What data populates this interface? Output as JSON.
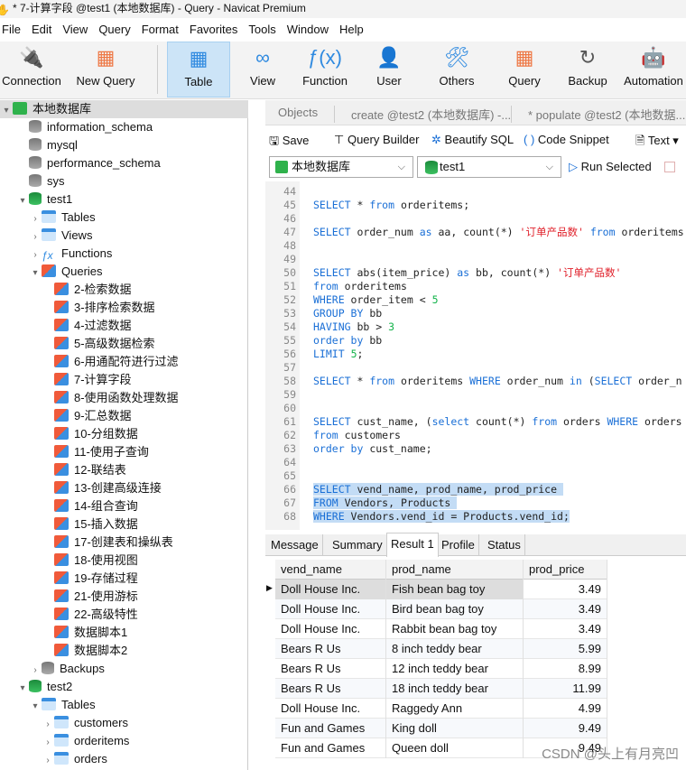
{
  "window": {
    "title": "* 7-计算字段 @test1 (本地数据库) - Query - Navicat Premium"
  },
  "menu": [
    "File",
    "Edit",
    "View",
    "Query",
    "Format",
    "Favorites",
    "Tools",
    "Window",
    "Help"
  ],
  "toolbar": [
    {
      "label": "Connection",
      "icon": "connection-plug-icon"
    },
    {
      "label": "New Query",
      "icon": "new-query-icon"
    },
    {
      "label": "Table",
      "icon": "table-icon",
      "active": true
    },
    {
      "label": "View",
      "icon": "view-icon"
    },
    {
      "label": "Function",
      "icon": "function-icon"
    },
    {
      "label": "User",
      "icon": "user-icon"
    },
    {
      "label": "Others",
      "icon": "others-tools-icon"
    },
    {
      "label": "Query",
      "icon": "query-icon"
    },
    {
      "label": "Backup",
      "icon": "backup-icon"
    },
    {
      "label": "Automation",
      "icon": "automation-robot-icon"
    }
  ],
  "tree": [
    {
      "label": "本地数据库",
      "level": 0,
      "type": "mysql",
      "tw": "▾",
      "sel": true
    },
    {
      "label": "information_schema",
      "level": 1,
      "type": "db"
    },
    {
      "label": "mysql",
      "level": 1,
      "type": "db"
    },
    {
      "label": "performance_schema",
      "level": 1,
      "type": "db"
    },
    {
      "label": "sys",
      "level": 1,
      "type": "db"
    },
    {
      "label": "test1",
      "level": 1,
      "type": "dbg",
      "tw": "▾"
    },
    {
      "label": "Tables",
      "level": 2,
      "type": "tbl",
      "tw": "›"
    },
    {
      "label": "Views",
      "level": 2,
      "type": "tbl",
      "tw": "›"
    },
    {
      "label": "Functions",
      "level": 2,
      "type": "fn",
      "tw": "›"
    },
    {
      "label": "Queries",
      "level": 2,
      "type": "qry",
      "tw": "▾"
    },
    {
      "label": "2-检索数据",
      "level": 3,
      "type": "qry"
    },
    {
      "label": "3-排序检索数据",
      "level": 3,
      "type": "qry"
    },
    {
      "label": "4-过滤数据",
      "level": 3,
      "type": "qry"
    },
    {
      "label": "5-高级数据检索",
      "level": 3,
      "type": "qry"
    },
    {
      "label": "6-用通配符进行过滤",
      "level": 3,
      "type": "qry"
    },
    {
      "label": "7-计算字段",
      "level": 3,
      "type": "qry"
    },
    {
      "label": "8-使用函数处理数据",
      "level": 3,
      "type": "qry"
    },
    {
      "label": "9-汇总数据",
      "level": 3,
      "type": "qry"
    },
    {
      "label": "10-分组数据",
      "level": 3,
      "type": "qry"
    },
    {
      "label": "11-使用子查询",
      "level": 3,
      "type": "qry"
    },
    {
      "label": "12-联结表",
      "level": 3,
      "type": "qry"
    },
    {
      "label": "13-创建高级连接",
      "level": 3,
      "type": "qry"
    },
    {
      "label": "14-组合查询",
      "level": 3,
      "type": "qry"
    },
    {
      "label": "15-插入数据",
      "level": 3,
      "type": "qry"
    },
    {
      "label": "17-创建表和操纵表",
      "level": 3,
      "type": "qry"
    },
    {
      "label": "18-使用视图",
      "level": 3,
      "type": "qry"
    },
    {
      "label": "19-存储过程",
      "level": 3,
      "type": "qry"
    },
    {
      "label": "21-使用游标",
      "level": 3,
      "type": "qry"
    },
    {
      "label": "22-高级特性",
      "level": 3,
      "type": "qry"
    },
    {
      "label": "数据脚本1",
      "level": 3,
      "type": "qry"
    },
    {
      "label": "数据脚本2",
      "level": 3,
      "type": "qry"
    },
    {
      "label": "Backups",
      "level": 2,
      "type": "db",
      "tw": "›"
    },
    {
      "label": "test2",
      "level": 1,
      "type": "dbg",
      "tw": "▾"
    },
    {
      "label": "Tables",
      "level": 2,
      "type": "tbl",
      "tw": "▾"
    },
    {
      "label": "customers",
      "level": 3,
      "type": "tbl",
      "tw": "›"
    },
    {
      "label": "orderitems",
      "level": 3,
      "type": "tbl",
      "tw": "›"
    },
    {
      "label": "orders",
      "level": 3,
      "type": "tbl",
      "tw": "›"
    }
  ],
  "tabs": [
    "Objects",
    "create @test2 (本地数据库) -...",
    "* populate @test2 (本地数据..."
  ],
  "query_toolbar": {
    "save": "Save",
    "query_builder": "Query Builder",
    "beautify": "Beautify SQL",
    "snippet": "Code Snippet",
    "text": "Text"
  },
  "connection_select": "本地数据库",
  "database_select": "test1",
  "run_selected": "Run Selected",
  "code": [
    {
      "n": "44",
      "t": []
    },
    {
      "n": "45",
      "t": [
        [
          "SELECT",
          "k"
        ],
        [
          " * ",
          "p"
        ],
        [
          "from",
          "k"
        ],
        [
          " orderitems;",
          "p"
        ]
      ]
    },
    {
      "n": "46",
      "t": []
    },
    {
      "n": "47",
      "t": [
        [
          "SELECT",
          "k"
        ],
        [
          " order_num ",
          "p"
        ],
        [
          "as",
          "k"
        ],
        [
          " aa, count(*) ",
          "p"
        ],
        [
          "'订单产品数'",
          "s"
        ],
        [
          " ",
          "p"
        ],
        [
          "from",
          "k"
        ],
        [
          " orderitems",
          "p"
        ]
      ]
    },
    {
      "n": "48",
      "t": []
    },
    {
      "n": "49",
      "t": []
    },
    {
      "n": "50",
      "t": [
        [
          "SELECT",
          "k"
        ],
        [
          " abs(item_price) ",
          "p"
        ],
        [
          "as",
          "k"
        ],
        [
          " bb, count(*) ",
          "p"
        ],
        [
          "'订单产品数'",
          "s"
        ]
      ]
    },
    {
      "n": "51",
      "t": [
        [
          "from",
          "k"
        ],
        [
          " orderitems",
          "p"
        ]
      ]
    },
    {
      "n": "52",
      "t": [
        [
          "WHERE",
          "k"
        ],
        [
          " order_item < ",
          "p"
        ],
        [
          "5",
          "n"
        ]
      ]
    },
    {
      "n": "53",
      "t": [
        [
          "GROUP BY",
          "k"
        ],
        [
          " bb",
          "p"
        ]
      ]
    },
    {
      "n": "54",
      "t": [
        [
          "HAVING",
          "k"
        ],
        [
          " bb > ",
          "p"
        ],
        [
          "3",
          "n"
        ]
      ]
    },
    {
      "n": "55",
      "t": [
        [
          "order by",
          "k"
        ],
        [
          " bb",
          "p"
        ]
      ]
    },
    {
      "n": "56",
      "t": [
        [
          "LIMIT",
          "k"
        ],
        [
          " ",
          "p"
        ],
        [
          "5",
          "n"
        ],
        [
          ";",
          "p"
        ]
      ]
    },
    {
      "n": "57",
      "t": []
    },
    {
      "n": "58",
      "t": [
        [
          "SELECT",
          "k"
        ],
        [
          " * ",
          "p"
        ],
        [
          "from",
          "k"
        ],
        [
          " orderitems ",
          "p"
        ],
        [
          "WHERE",
          "k"
        ],
        [
          " order_num ",
          "p"
        ],
        [
          "in",
          "k"
        ],
        [
          " (",
          "p"
        ],
        [
          "SELECT",
          "k"
        ],
        [
          " order_n",
          "p"
        ]
      ]
    },
    {
      "n": "59",
      "t": []
    },
    {
      "n": "60",
      "t": []
    },
    {
      "n": "61",
      "t": [
        [
          "SELECT",
          "k"
        ],
        [
          " cust_name, (",
          "p"
        ],
        [
          "select",
          "k"
        ],
        [
          " count(*) ",
          "p"
        ],
        [
          "from",
          "k"
        ],
        [
          " orders ",
          "p"
        ],
        [
          "WHERE",
          "k"
        ],
        [
          " orders",
          "p"
        ]
      ]
    },
    {
      "n": "62",
      "t": [
        [
          "from",
          "k"
        ],
        [
          " customers",
          "p"
        ]
      ]
    },
    {
      "n": "63",
      "t": [
        [
          "order by",
          "k"
        ],
        [
          " cust_name;",
          "p"
        ]
      ]
    },
    {
      "n": "64",
      "t": []
    },
    {
      "n": "65",
      "t": []
    },
    {
      "n": "66",
      "hl": true,
      "t": [
        [
          "SELECT",
          "k"
        ],
        [
          " vend_name, prod_name, prod_price ",
          "p"
        ]
      ]
    },
    {
      "n": "67",
      "hl": true,
      "t": [
        [
          "FROM",
          "k"
        ],
        [
          " Vendors, Products ",
          "p"
        ]
      ]
    },
    {
      "n": "68",
      "hl": true,
      "t": [
        [
          "WHERE",
          "k"
        ],
        [
          " Vendors.vend_id = Products.vend_id;",
          "p"
        ]
      ]
    }
  ],
  "result_tabs": [
    "Message",
    "Summary",
    "Result 1",
    "Profile",
    "Status"
  ],
  "result_active": "Result 1",
  "columns": [
    "vend_name",
    "prod_name",
    "prod_price"
  ],
  "rows": [
    [
      "Doll House Inc.",
      "Fish bean bag toy",
      "3.49"
    ],
    [
      "Doll House Inc.",
      "Bird bean bag toy",
      "3.49"
    ],
    [
      "Doll House Inc.",
      "Rabbit bean bag toy",
      "3.49"
    ],
    [
      "Bears R Us",
      "8 inch teddy bear",
      "5.99"
    ],
    [
      "Bears R Us",
      "12 inch teddy bear",
      "8.99"
    ],
    [
      "Bears R Us",
      "18 inch teddy bear",
      "11.99"
    ],
    [
      "Doll House Inc.",
      "Raggedy Ann",
      "4.99"
    ],
    [
      "Fun and Games",
      "King doll",
      "9.49"
    ],
    [
      "Fun and Games",
      "Queen doll",
      "9.49"
    ]
  ],
  "watermark": "CSDN @头上有月亮凹"
}
